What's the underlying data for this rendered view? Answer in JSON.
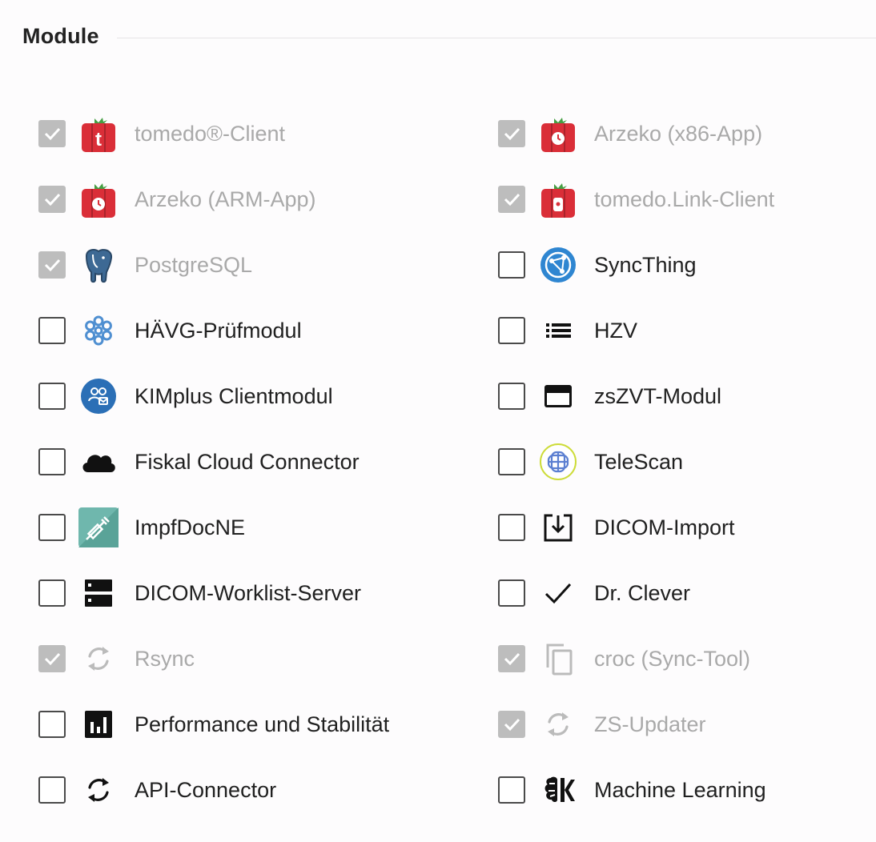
{
  "section": {
    "title": "Module"
  },
  "modules": {
    "left": [
      {
        "label": "tomedo®-Client",
        "checked": true,
        "disabled": true,
        "icon": "tomedo-t-icon"
      },
      {
        "label": "Arzeko (ARM-App)",
        "checked": true,
        "disabled": true,
        "icon": "tomedo-clock-icon"
      },
      {
        "label": "PostgreSQL",
        "checked": true,
        "disabled": true,
        "icon": "postgresql-elephant-icon"
      },
      {
        "label": "HÄVG-Prüfmodul",
        "checked": false,
        "disabled": false,
        "icon": "snowflake-icon"
      },
      {
        "label": "KIMplus Clientmodul",
        "checked": false,
        "disabled": false,
        "icon": "kim-people-icon"
      },
      {
        "label": "Fiskal Cloud Connector",
        "checked": false,
        "disabled": false,
        "icon": "cloud-icon"
      },
      {
        "label": "ImpfDocNE",
        "checked": false,
        "disabled": false,
        "icon": "syringe-icon"
      },
      {
        "label": "DICOM-Worklist-Server",
        "checked": false,
        "disabled": false,
        "icon": "server-icon"
      },
      {
        "label": "Rsync",
        "checked": true,
        "disabled": true,
        "icon": "sync-arrows-icon"
      },
      {
        "label": "Performance und Stabilität",
        "checked": false,
        "disabled": false,
        "icon": "bar-chart-icon"
      },
      {
        "label": "API-Connector",
        "checked": false,
        "disabled": false,
        "icon": "sync-arrows-icon"
      }
    ],
    "right": [
      {
        "label": "Arzeko (x86-App)",
        "checked": true,
        "disabled": true,
        "icon": "tomedo-clock-icon"
      },
      {
        "label": "tomedo.Link-Client",
        "checked": true,
        "disabled": true,
        "icon": "tomedo-link-icon"
      },
      {
        "label": "SyncThing",
        "checked": false,
        "disabled": false,
        "icon": "syncthing-icon"
      },
      {
        "label": "HZV",
        "checked": false,
        "disabled": false,
        "icon": "list-icon"
      },
      {
        "label": "zsZVT-Modul",
        "checked": false,
        "disabled": false,
        "icon": "credit-card-icon"
      },
      {
        "label": "TeleScan",
        "checked": false,
        "disabled": false,
        "icon": "telescan-icon"
      },
      {
        "label": "DICOM-Import",
        "checked": false,
        "disabled": false,
        "icon": "import-box-icon"
      },
      {
        "label": "Dr. Clever",
        "checked": false,
        "disabled": false,
        "icon": "checkmark-icon"
      },
      {
        "label": "croc (Sync-Tool)",
        "checked": true,
        "disabled": true,
        "icon": "copy-icon"
      },
      {
        "label": "ZS-Updater",
        "checked": true,
        "disabled": true,
        "icon": "sync-arrows-icon"
      },
      {
        "label": "Machine Learning",
        "checked": false,
        "disabled": false,
        "icon": "brain-icon"
      }
    ]
  },
  "colors": {
    "checked_box": "#bdbdbd",
    "disabled_text": "#a9a9a9",
    "text": "#202020",
    "tomedo_red": "#d9232e",
    "syncthing_blue": "#2f86d1",
    "kim_blue": "#2b6fb6",
    "impf_teal": "#6fb7ad"
  }
}
